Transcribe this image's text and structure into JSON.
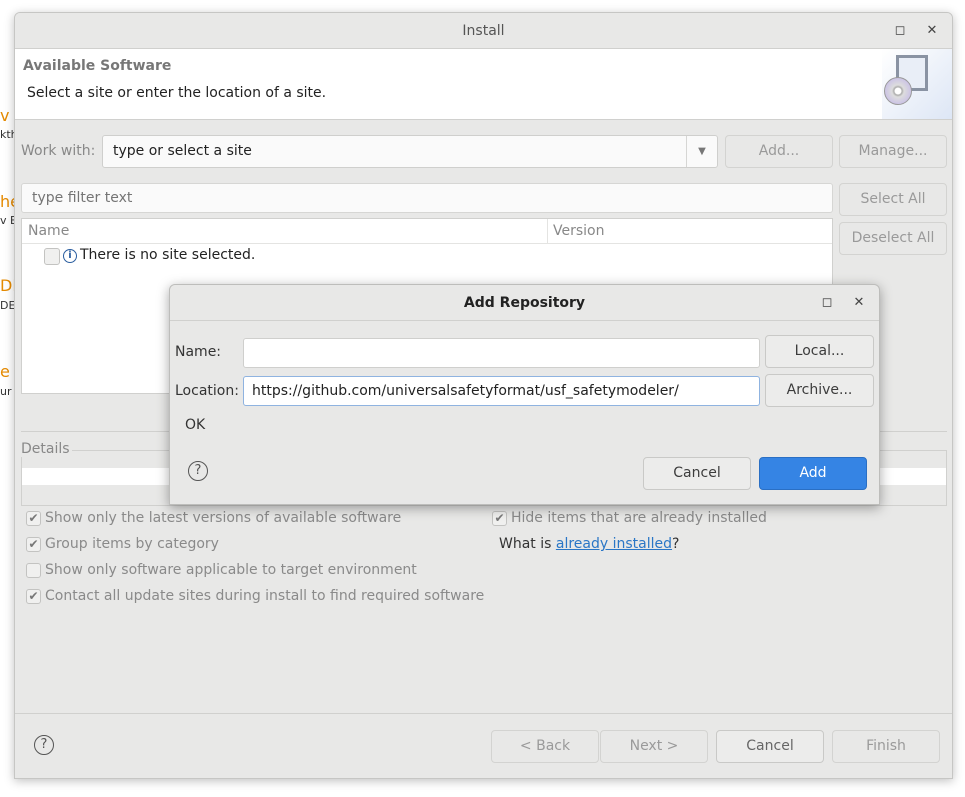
{
  "background_fragments": [
    "v t",
    "kth",
    "he",
    "v E",
    "DE",
    "DE",
    "e",
    "ur I"
  ],
  "window": {
    "title": "Install",
    "header_title": "Available Software",
    "header_subtitle": "Select a site or enter the location of a site.",
    "work_with_label": "Work with:",
    "work_with_value": "type or select a site",
    "add_button": "Add...",
    "manage_button": "Manage...",
    "filter_placeholder": "type filter text",
    "select_all": "Select All",
    "deselect_all": "Deselect All",
    "table": {
      "columns": [
        "Name",
        "Version"
      ],
      "rows": [
        {
          "name": "There is no site selected.",
          "checked": false
        }
      ]
    },
    "details_label": "Details",
    "options": [
      {
        "label": "Show only the latest versions of available software",
        "checked": true
      },
      {
        "label": "Group items by category",
        "checked": true
      },
      {
        "label": "Show only software applicable to target environment",
        "checked": false
      },
      {
        "label": "Contact all update sites during install to find required software",
        "checked": true
      },
      {
        "label": "Hide items that are already installed",
        "checked": true
      }
    ],
    "what_is_prefix": "What is ",
    "what_is_link": "already installed",
    "what_is_suffix": "?",
    "footer": {
      "back": "< Back",
      "next": "Next >",
      "cancel": "Cancel",
      "finish": "Finish"
    }
  },
  "dialog": {
    "title": "Add Repository",
    "name_label": "Name:",
    "name_value": "",
    "location_label": "Location:",
    "location_value": "https://github.com/universalsafetyformat/usf_safetymodeler/",
    "local_button": "Local...",
    "archive_button": "Archive...",
    "status": "OK",
    "cancel_button": "Cancel",
    "add_button": "Add"
  },
  "colors": {
    "accent": "#3584e4",
    "link": "#2a76c6",
    "background_fragment": "#e58a00"
  }
}
